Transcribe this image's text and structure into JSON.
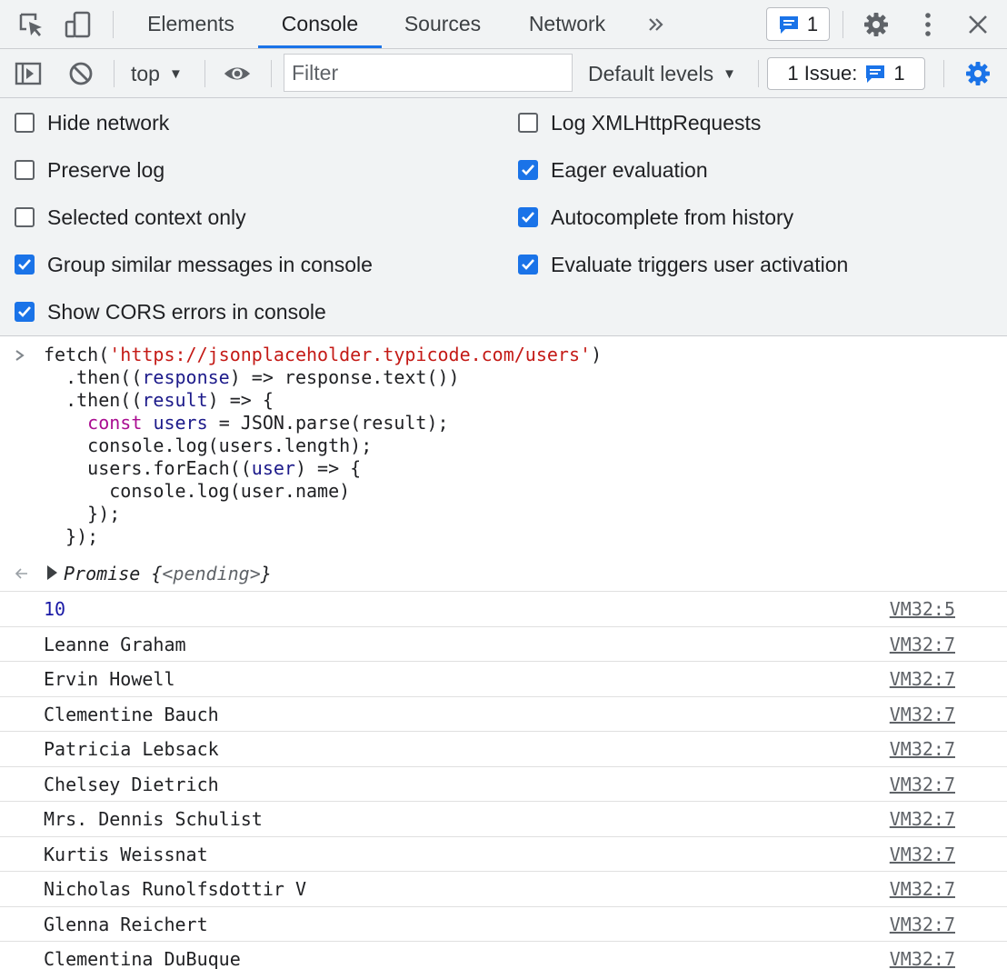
{
  "tabs": [
    {
      "label": "Elements"
    },
    {
      "label": "Console"
    },
    {
      "label": "Sources"
    },
    {
      "label": "Network"
    }
  ],
  "tabbar": {
    "more_tabs_icon": "double-chevron-right-icon",
    "messages_count": "1"
  },
  "toolbar": {
    "context": "top",
    "filter_placeholder": "Filter",
    "levels": "Default levels",
    "issues_label": "1 Issue:",
    "issues_count": "1"
  },
  "settings": {
    "left": [
      {
        "label": "Hide network",
        "checked": false
      },
      {
        "label": "Preserve log",
        "checked": false
      },
      {
        "label": "Selected context only",
        "checked": false
      },
      {
        "label": "Group similar messages in console",
        "checked": true
      },
      {
        "label": "Show CORS errors in console",
        "checked": true
      }
    ],
    "right": [
      {
        "label": "Log XMLHttpRequests",
        "checked": false
      },
      {
        "label": "Eager evaluation",
        "checked": true
      },
      {
        "label": "Autocomplete from history",
        "checked": true
      },
      {
        "label": "Evaluate triggers user activation",
        "checked": true
      }
    ]
  },
  "console": {
    "input_code": [
      "fetch('https://jsonplaceholder.typicode.com/users')",
      "  .then((response) => response.text())",
      "  .then((result) => {",
      "    const users = JSON.parse(result);",
      "    console.log(users.length);",
      "    users.forEach((user) => {",
      "      console.log(user.name)",
      "    });",
      "  });"
    ],
    "result": {
      "prefix": "Promise {",
      "state": "<pending>",
      "suffix": "}"
    },
    "logs": [
      {
        "message": "10",
        "source": "VM32:5",
        "numeric": true
      },
      {
        "message": "Leanne Graham",
        "source": "VM32:7"
      },
      {
        "message": "Ervin Howell",
        "source": "VM32:7"
      },
      {
        "message": "Clementine Bauch",
        "source": "VM32:7"
      },
      {
        "message": "Patricia Lebsack",
        "source": "VM32:7"
      },
      {
        "message": "Chelsey Dietrich",
        "source": "VM32:7"
      },
      {
        "message": "Mrs. Dennis Schulist",
        "source": "VM32:7"
      },
      {
        "message": "Kurtis Weissnat",
        "source": "VM32:7"
      },
      {
        "message": "Nicholas Runolfsdottir V",
        "source": "VM32:7"
      },
      {
        "message": "Glenna Reichert",
        "source": "VM32:7"
      },
      {
        "message": "Clementina DuBuque",
        "source": "VM32:7"
      }
    ]
  },
  "colors": {
    "accent": "#1a73e8",
    "toolbar_bg": "#f1f3f4",
    "string": "#c41a16",
    "keyword": "#aa0d91"
  }
}
